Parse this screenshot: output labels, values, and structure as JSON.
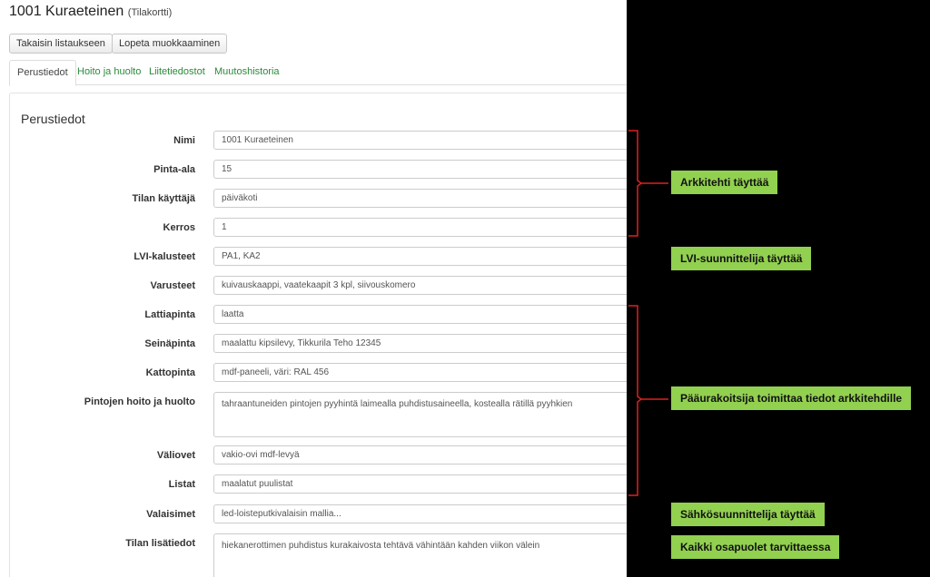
{
  "page": {
    "title": "1001 Kuraeteinen",
    "subtitle": "(Tilakortti)"
  },
  "toolbar": {
    "back_label": "Takaisin listaukseen",
    "stop_label": "Lopeta muokkaaminen"
  },
  "tabs": [
    {
      "label": "Perustiedot",
      "active": true
    },
    {
      "label": "Hoito ja huolto",
      "active": false
    },
    {
      "label": "Liitetiedostot",
      "active": false
    },
    {
      "label": "Muutoshistoria",
      "active": false
    }
  ],
  "section": {
    "title": "Perustiedot"
  },
  "fields": [
    {
      "label": "Nimi",
      "value": "1001 Kuraeteinen"
    },
    {
      "label": "Pinta-ala",
      "value": "15"
    },
    {
      "label": "Tilan käyttäjä",
      "value": "päiväkoti"
    },
    {
      "label": "Kerros",
      "value": "1"
    },
    {
      "label": "LVI-kalusteet",
      "value": "PA1, KA2"
    },
    {
      "label": "Varusteet",
      "value": "kuivauskaappi, vaatekaapit 3 kpl, siivouskomero"
    },
    {
      "label": "Lattiapinta",
      "value": "laatta"
    },
    {
      "label": "Seinäpinta",
      "value": "maalattu kipsilevy, Tikkurila Teho 12345"
    },
    {
      "label": "Kattopinta",
      "value": "mdf-paneeli, väri: RAL 456"
    },
    {
      "label": "Pintojen hoito ja huolto",
      "value": "tahraantuneiden pintojen pyyhintä laimealla puhdistusaineella, kostealla rätillä pyyhkien"
    },
    {
      "label": "Väliovet",
      "value": "vakio-ovi mdf-levyä"
    },
    {
      "label": "Listat",
      "value": "maalatut puulistat"
    },
    {
      "label": "Valaisimet",
      "value": "led-loisteputkivalaisin mallia..."
    },
    {
      "label": "Tilan lisätiedot",
      "value": "hiekanerottimen puhdistus kurakaivosta tehtävä vähintään kahden viikon välein"
    }
  ],
  "annotations": {
    "architect": "Arkkitehti täyttää",
    "hvac": "LVI-suunnittelija täyttää",
    "contractor": "Pääurakoitsija toimittaa tiedot arkkitehdille",
    "electrical": "Sähkösuunnittelija täyttää",
    "all": "Kaikki osapuolet tarvittaessa"
  },
  "colors": {
    "annotation_bg": "#92d050",
    "bracket": "#e02020",
    "tab_link": "#2a8a3a"
  }
}
